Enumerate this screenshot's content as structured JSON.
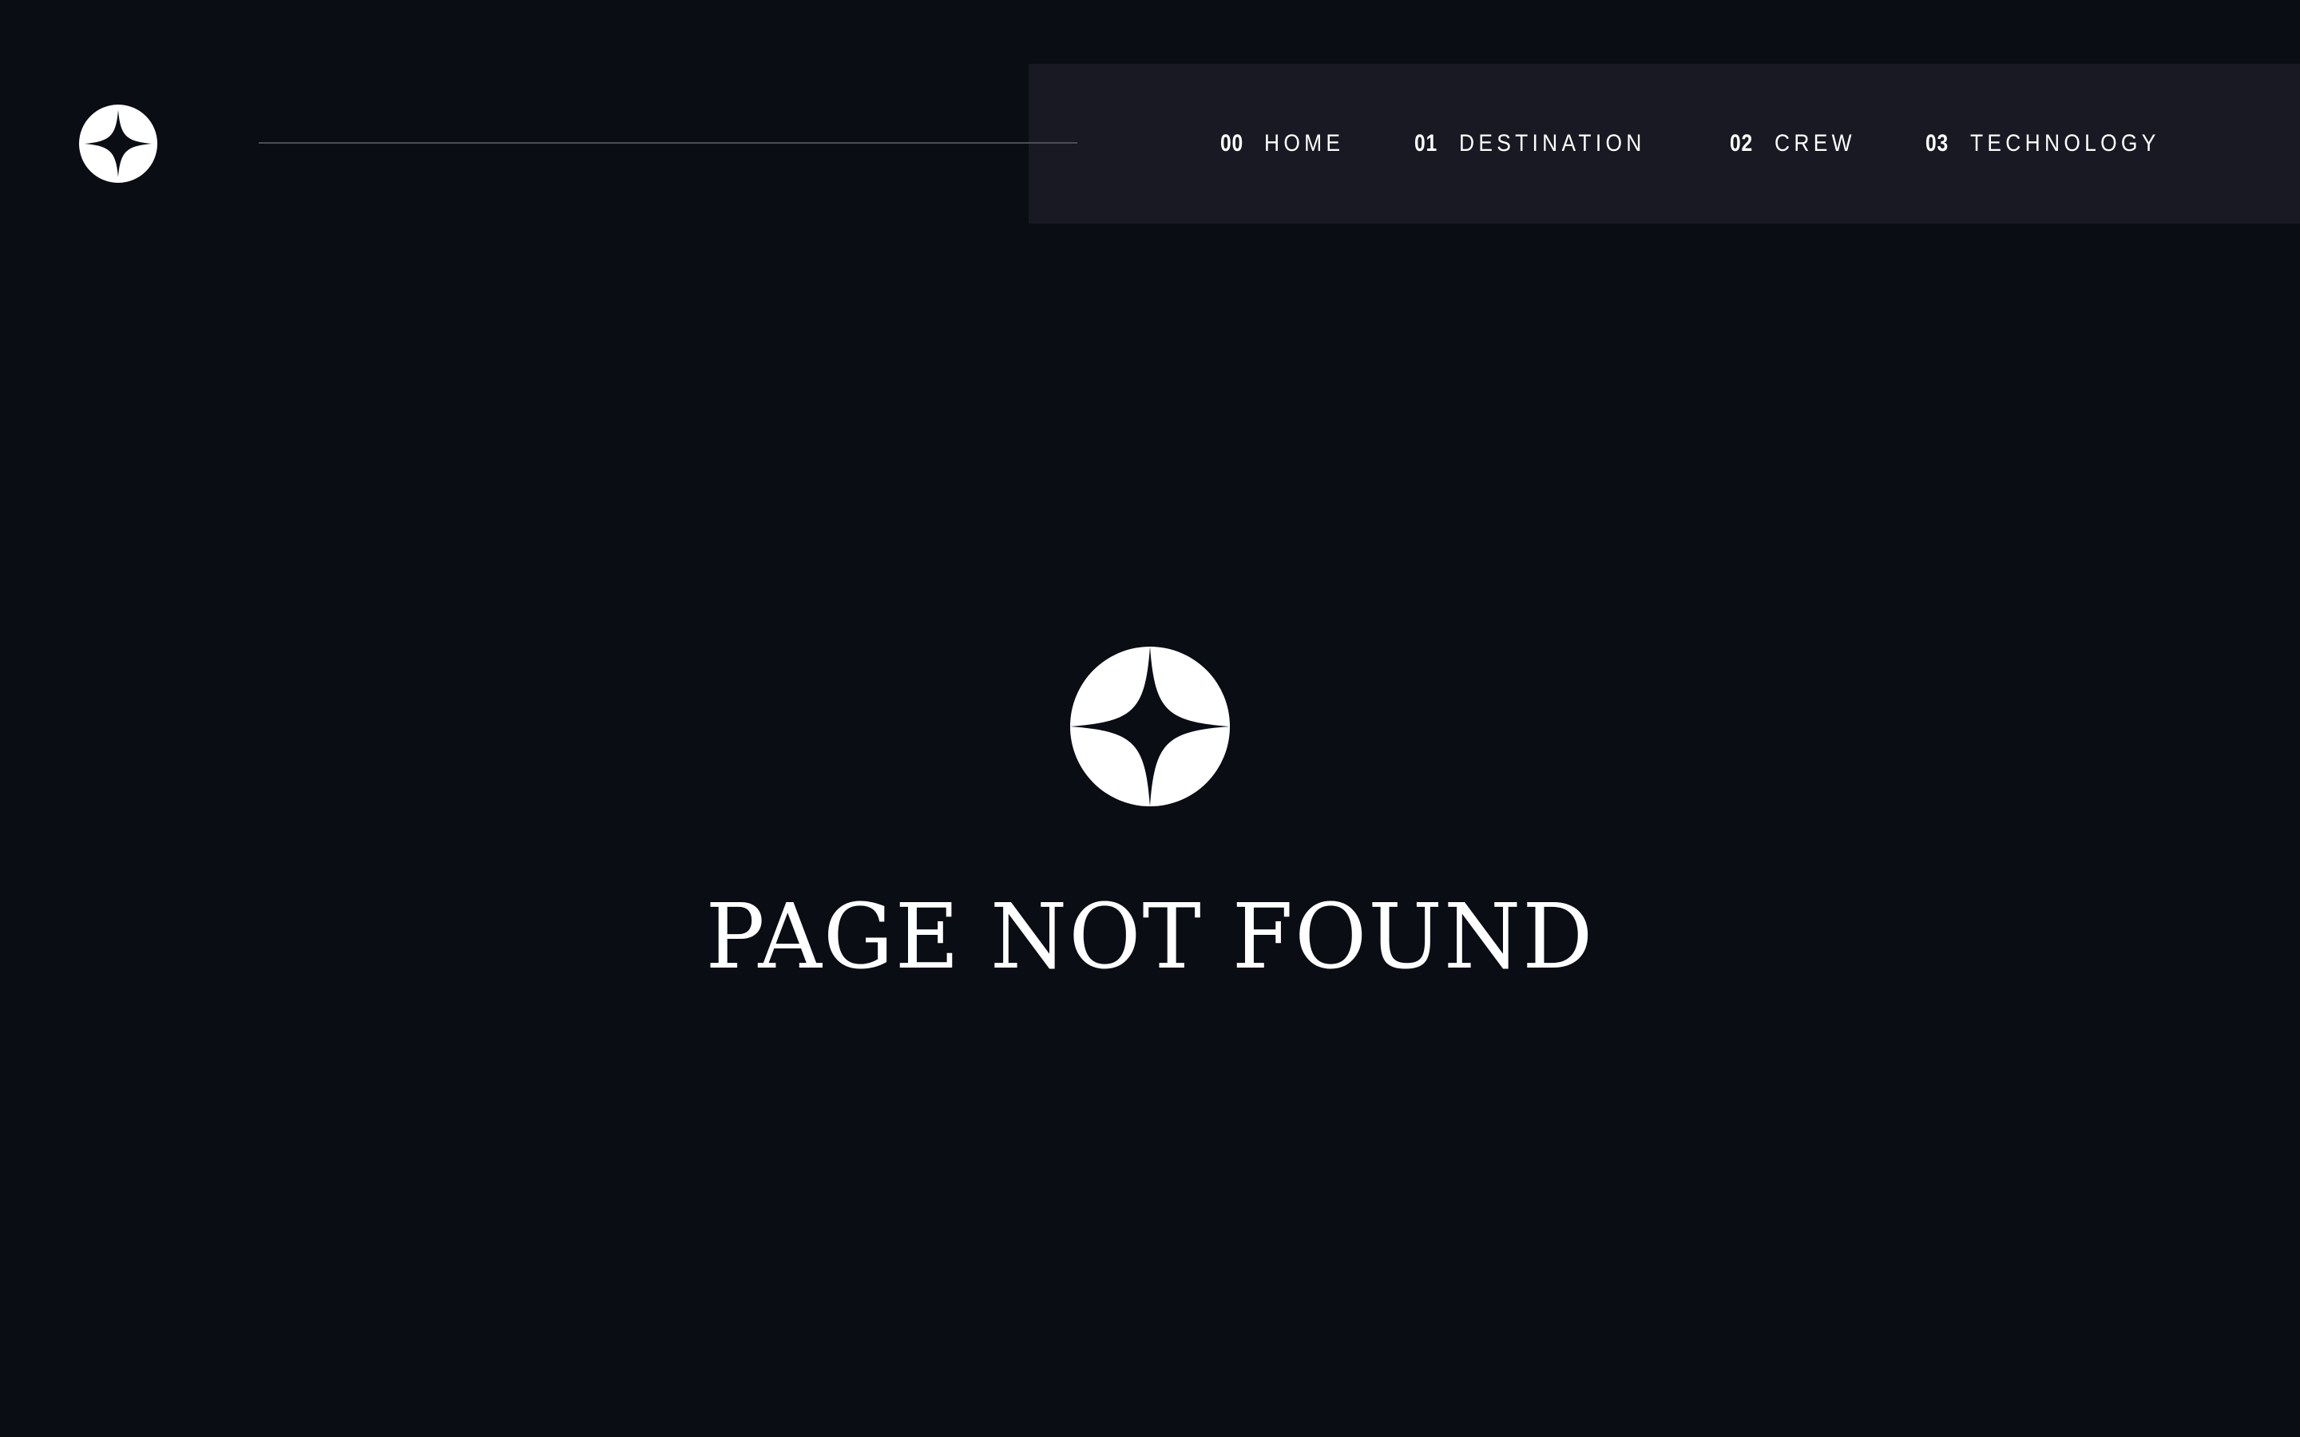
{
  "header": {
    "logo_icon": "star-logo-icon",
    "nav": [
      {
        "number": "00",
        "label": "HOME"
      },
      {
        "number": "01",
        "label": "DESTINATION"
      },
      {
        "number": "02",
        "label": "CREW"
      },
      {
        "number": "03",
        "label": "TECHNOLOGY"
      }
    ]
  },
  "main": {
    "icon": "star-logo-icon",
    "title": "PAGE NOT FOUND"
  },
  "colors": {
    "background": "#0b0d15",
    "nav_panel": "#181922",
    "divider": "#4a4d56",
    "text": "#ffffff"
  }
}
